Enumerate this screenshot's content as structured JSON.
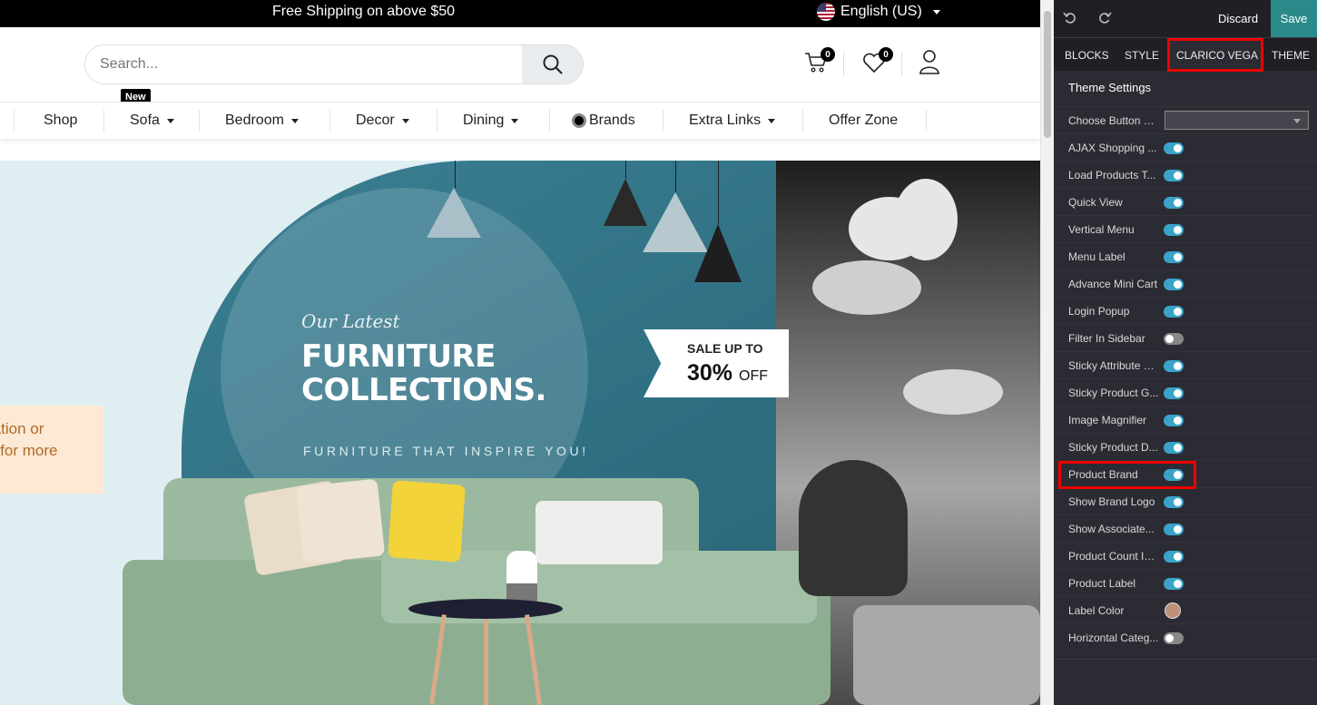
{
  "topbar": {
    "shipping": "Free Shipping on above $50",
    "language": "English (US)"
  },
  "search": {
    "placeholder": "Search..."
  },
  "header": {
    "cart_count": "0",
    "wishlist_count": "0"
  },
  "nav": {
    "items": [
      {
        "label": "Shop"
      },
      {
        "label": "Sofa",
        "badge": "New"
      },
      {
        "label": "Bedroom"
      },
      {
        "label": "Decor"
      },
      {
        "label": "Dining"
      },
      {
        "label": "Brands"
      },
      {
        "label": "Extra Links"
      },
      {
        "label": "Offer Zone"
      }
    ]
  },
  "banner": {
    "kicker": "Our Latest",
    "title": "FURNITURE COLLECTIONS.",
    "tagline": "FURNITURE THAT INSPIRE YOU!",
    "sale_line1": "SALE UP TO",
    "sale_percent": "30%",
    "sale_off": "OFF",
    "cta_line1": "ration or",
    "cta_line2": "p for more"
  },
  "panel": {
    "discard": "Discard",
    "save": "Save",
    "tabs": [
      "BLOCKS",
      "STYLE",
      "CLARICO VEGA",
      "THEME"
    ],
    "section": "Theme Settings",
    "settings": [
      {
        "label": "Choose Button S...",
        "type": "select"
      },
      {
        "label": "AJAX Shopping ...",
        "type": "toggle",
        "on": true
      },
      {
        "label": "Load Products T...",
        "type": "toggle",
        "on": true
      },
      {
        "label": "Quick View",
        "type": "toggle",
        "on": true
      },
      {
        "label": "Vertical Menu",
        "type": "toggle",
        "on": true
      },
      {
        "label": "Menu Label",
        "type": "toggle",
        "on": true
      },
      {
        "label": "Advance Mini Cart",
        "type": "toggle",
        "on": true
      },
      {
        "label": "Login Popup",
        "type": "toggle",
        "on": true
      },
      {
        "label": "Filter In Sidebar",
        "type": "toggle",
        "on": false
      },
      {
        "label": "Sticky Attribute &...",
        "type": "toggle",
        "on": true
      },
      {
        "label": "Sticky Product G...",
        "type": "toggle",
        "on": true
      },
      {
        "label": "Image Magnifier",
        "type": "toggle",
        "on": true
      },
      {
        "label": "Sticky Product D...",
        "type": "toggle",
        "on": true
      },
      {
        "label": "Product Brand",
        "type": "toggle",
        "on": true
      },
      {
        "label": "Show Brand Logo",
        "type": "toggle",
        "on": true
      },
      {
        "label": "Show Associate...",
        "type": "toggle",
        "on": true
      },
      {
        "label": "Product Count In...",
        "type": "toggle",
        "on": true
      },
      {
        "label": "Product Label",
        "type": "toggle",
        "on": true
      },
      {
        "label": "Label Color",
        "type": "color",
        "color": "#bf917a"
      },
      {
        "label": "Horizontal Categ...",
        "type": "toggle",
        "on": false
      }
    ]
  },
  "colors": {
    "save_bg": "#2a8a8a",
    "toggle_on": "#3aa3c9",
    "highlight": "#ee0000"
  }
}
